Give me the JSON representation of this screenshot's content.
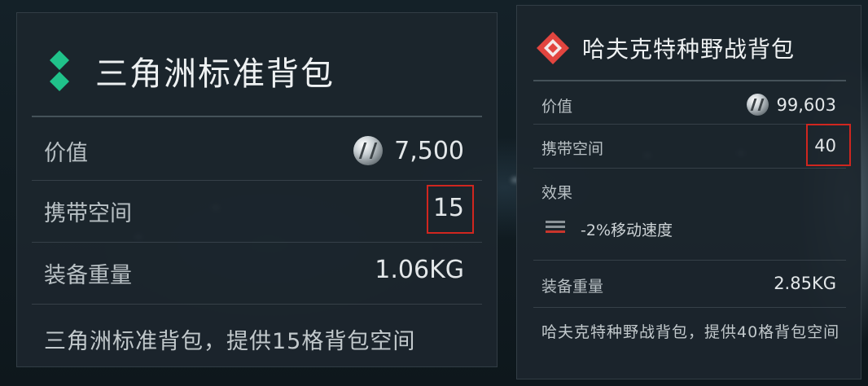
{
  "left_panel": {
    "title": "三角洲标准背包",
    "value_label": "价值",
    "value": "7,500",
    "capacity_label": "携带空间",
    "capacity": "15",
    "weight_label": "装备重量",
    "weight": "1.06KG",
    "description": "三角洲标准背包，提供15格背包空间",
    "icon": "green-diamonds-icon",
    "accent_color": "#20c28a"
  },
  "right_panel": {
    "title": "哈夫克特种野战背包",
    "value_label": "价值",
    "value": "99,603",
    "capacity_label": "携带空间",
    "capacity": "40",
    "effect_label": "效果",
    "effect_text": "-2%移动速度",
    "weight_label": "装备重量",
    "weight": "2.85KG",
    "description": "哈夫克特种野战背包，提供40格背包空间",
    "icon": "red-diamond-icon",
    "accent_color": "#e2453f"
  },
  "highlight_color": "#d0261f"
}
